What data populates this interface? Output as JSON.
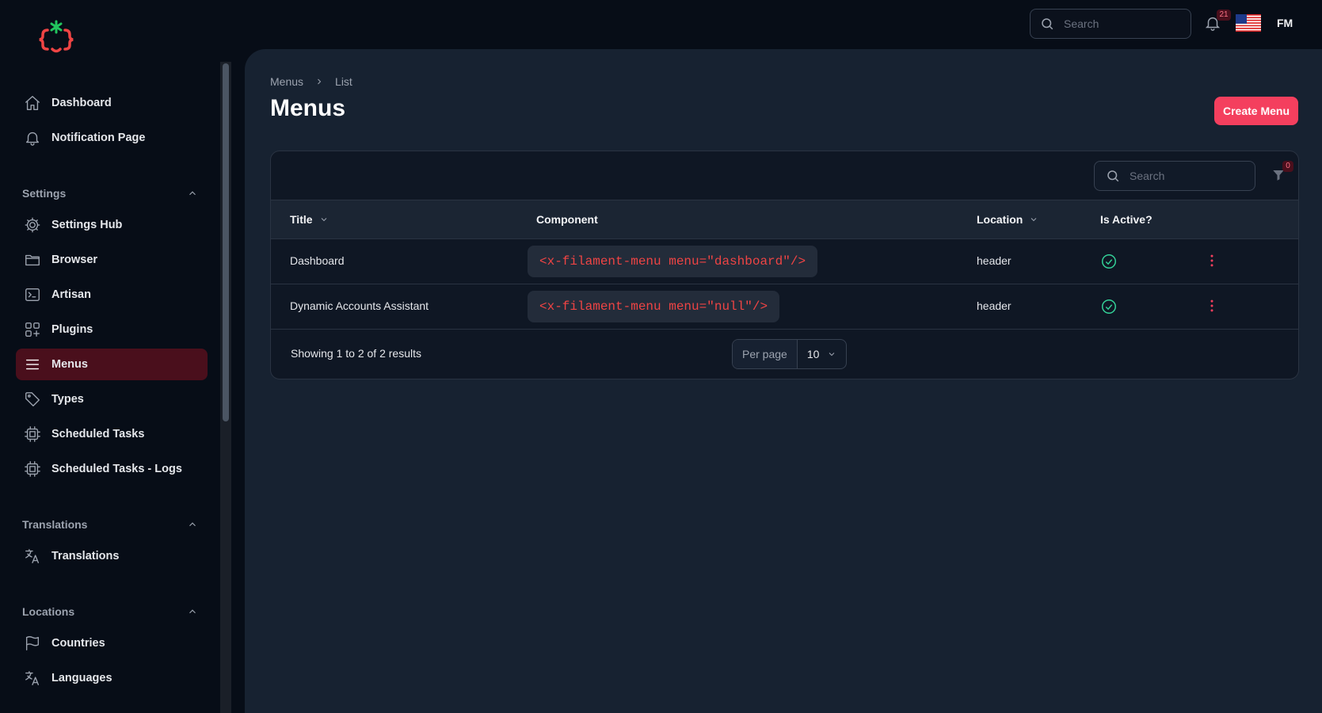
{
  "topbar": {
    "search_placeholder": "Search",
    "notification_count": "21",
    "user_initials": "FM",
    "flag_icon": "us-flag-icon"
  },
  "sidebar": {
    "items_top": [
      {
        "label": "Dashboard",
        "icon": "home-icon"
      },
      {
        "label": "Notification Page",
        "icon": "bell-icon"
      }
    ],
    "groups": [
      {
        "label": "Settings",
        "items": [
          {
            "label": "Settings Hub",
            "icon": "cog-icon"
          },
          {
            "label": "Browser",
            "icon": "folder-icon"
          },
          {
            "label": "Artisan",
            "icon": "terminal-icon"
          },
          {
            "label": "Plugins",
            "icon": "plugins-icon"
          },
          {
            "label": "Menus",
            "icon": "menu-icon",
            "active": true
          },
          {
            "label": "Types",
            "icon": "tag-icon"
          },
          {
            "label": "Scheduled Tasks",
            "icon": "cpu-icon"
          },
          {
            "label": "Scheduled Tasks - Logs",
            "icon": "cpu-icon"
          }
        ]
      },
      {
        "label": "Translations",
        "items": [
          {
            "label": "Translations",
            "icon": "translate-icon"
          }
        ]
      },
      {
        "label": "Locations",
        "items": [
          {
            "label": "Countries",
            "icon": "flag-icon"
          },
          {
            "label": "Languages",
            "icon": "translate-icon"
          }
        ]
      }
    ]
  },
  "breadcrumb": {
    "first": "Menus",
    "second": "List"
  },
  "page": {
    "title": "Menus",
    "create_label": "Create Menu"
  },
  "table": {
    "search_placeholder": "Search",
    "filter_count": "0",
    "columns": {
      "title": "Title",
      "component": "Component",
      "location": "Location",
      "active": "Is Active?"
    },
    "rows": [
      {
        "title": "Dashboard",
        "component": "<x-filament-menu menu=\"dashboard\"/>",
        "location": "header",
        "active": true
      },
      {
        "title": "Dynamic Accounts Assistant",
        "component": "<x-filament-menu menu=\"null\"/>",
        "location": "header",
        "active": true
      }
    ],
    "footer": {
      "showing": "Showing 1 to 2 of 2 results",
      "per_page_label": "Per page",
      "per_page_value": "10"
    }
  },
  "colors": {
    "accent": "#f43f5e",
    "active_nav": "#4a0f1c",
    "success": "#34d399",
    "code": "#ef4444"
  }
}
